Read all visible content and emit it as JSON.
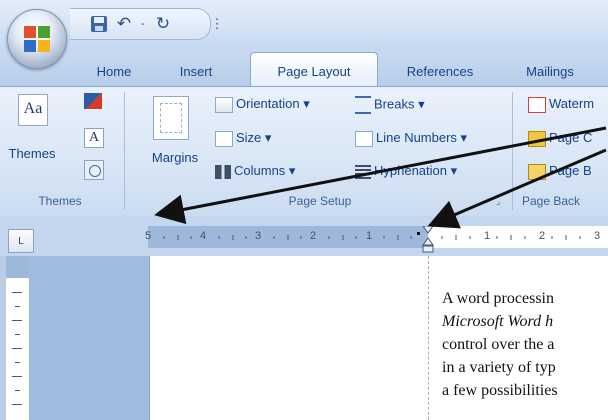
{
  "qat": {
    "undo_glyph": "↶",
    "redo_glyph": "↻",
    "dropdown_glyph": "⋮",
    "save_icon": "save-icon"
  },
  "tabs": [
    "Home",
    "Insert",
    "Page Layout",
    "References",
    "Mailings"
  ],
  "active_tab_index": 2,
  "ribbon": {
    "themes": {
      "group_label": "Themes",
      "big_button_label": "Themes",
      "big_icon_text": "Aa"
    },
    "page_setup": {
      "group_label": "Page Setup",
      "margins_label": "Margins",
      "orientation_label": "Orientation ▾",
      "size_label": "Size ▾",
      "columns_label": "Columns ▾",
      "breaks_label": "Breaks ▾",
      "line_numbers_label": "Line Numbers ▾",
      "hyphenation_label": "Hyphenation ▾"
    },
    "page_background": {
      "group_label": "Page Back",
      "watermark_label": "Waterm",
      "page_color_label": "Page C",
      "page_borders_label": "Page B"
    }
  },
  "ruler": {
    "tab_selector_glyph": "L",
    "left_numbers": [
      "5",
      "4",
      "3",
      "2",
      "1"
    ],
    "right_numbers": [
      "1",
      "2",
      "3"
    ]
  },
  "document": {
    "lines": [
      "A word processin",
      "Microsoft Word h",
      "control over the a",
      "in a variety of typ",
      "a few possibilities"
    ]
  },
  "colors": {
    "arrow": "#111111",
    "ribbon_text": "#15428b",
    "accent": "#8aa8d3"
  }
}
